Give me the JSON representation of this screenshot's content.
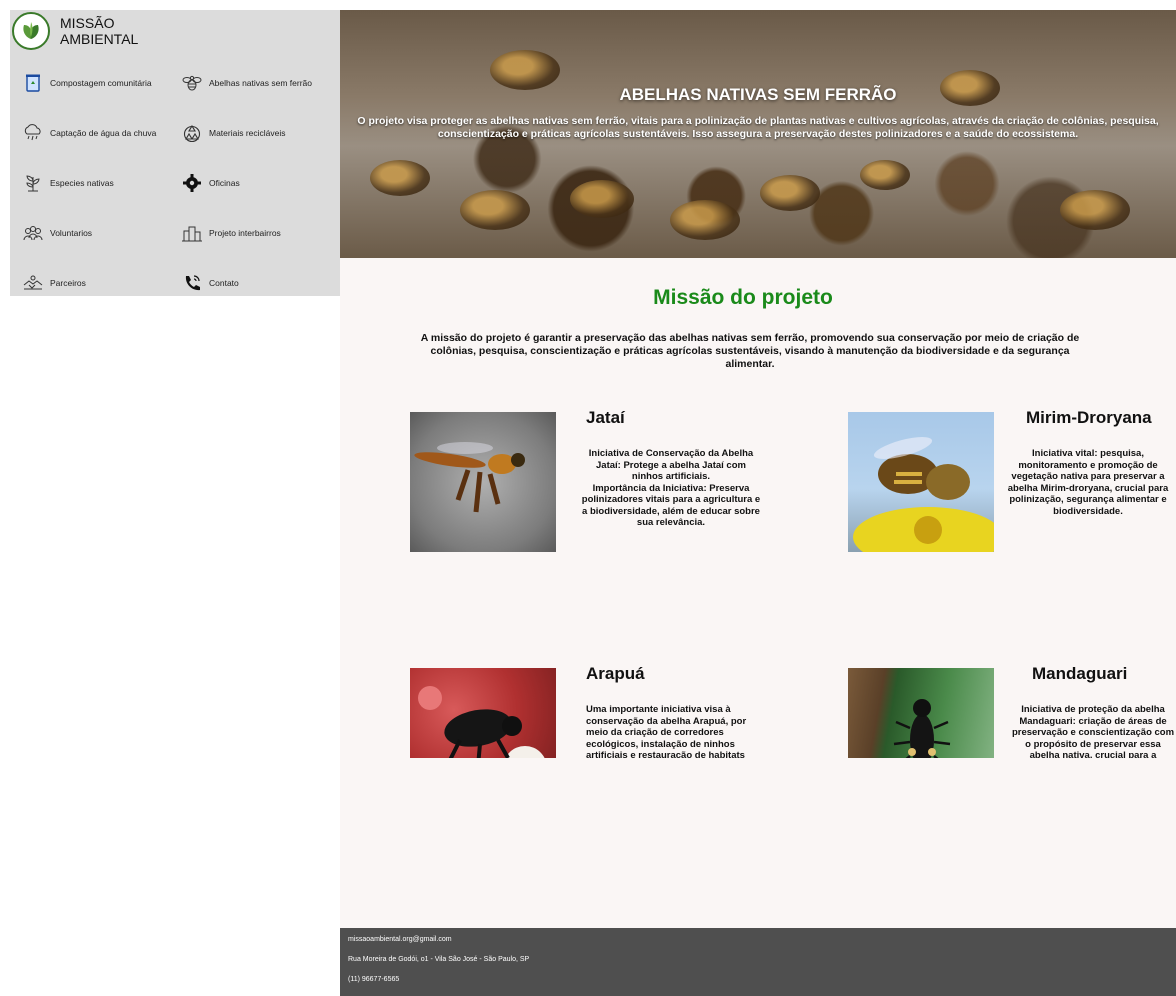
{
  "brand": {
    "line1": "MISSÃO",
    "line2": "AMBIENTAL"
  },
  "nav": [
    {
      "label": "Compostagem comunitária",
      "icon": "compost-bin-icon"
    },
    {
      "label": "Abelhas nativas sem ferrão",
      "icon": "bee-icon"
    },
    {
      "label": "Captação de água da chuva",
      "icon": "rain-cloud-icon"
    },
    {
      "label": "Materiais recicláveis",
      "icon": "recycle-icon"
    },
    {
      "label": "Especies nativas",
      "icon": "plant-icon"
    },
    {
      "label": "Oficinas",
      "icon": "gear-icon"
    },
    {
      "label": "Voluntarios",
      "icon": "people-icon"
    },
    {
      "label": "Projeto interbairros",
      "icon": "city-icon"
    },
    {
      "label": "Parceiros",
      "icon": "handshake-icon"
    },
    {
      "label": "Contato",
      "icon": "phone-icon"
    }
  ],
  "hero": {
    "title": "ABELHAS NATIVAS SEM FERRÃO",
    "text": "O projeto visa proteger as abelhas nativas sem ferrão, vitais para a polinização de plantas nativas e cultivos agrícolas, através da criação de colônias, pesquisa, conscientização e práticas agrícolas sustentáveis. Isso assegura a preservação destes polinizadores e a saúde do ecossistema."
  },
  "mission": {
    "title": "Missão do projeto",
    "text": "A missão do projeto é garantir a preservação das abelhas nativas sem ferrão, promovendo sua conservação por meio de criação de colônias, pesquisa, conscientização e práticas agrícolas sustentáveis, visando à manutenção da biodiversidade e da segurança alimentar."
  },
  "cards": [
    {
      "title": "Jataí",
      "text": "Iniciativa de Conservação da Abelha Jataí: Protege a abelha Jataí com ninhos artificiais.\nImportância da Iniciativa: Preserva polinizadores vitais para a agricultura e a biodiversidade, além de educar sobre sua relevância."
    },
    {
      "title": "Mirim-Droryana",
      "text": "Iniciativa vital: pesquisa, monitoramento e promoção de vegetação nativa para preservar a abelha Mirim-droryana, crucial para polinização, segurança alimentar e biodiversidade."
    },
    {
      "title": "Arapuá",
      "text": "Uma importante iniciativa visa à conservação da abelha Arapuá, por meio da criação de corredores ecológicos, instalação de ninhos artificiais e restauração de habitats naturais. Isso é fundamental para a preservação da espécie, essencial na polinização e na manutenção da biodiversidade."
    },
    {
      "title": "Mandaguari",
      "text": "Iniciativa de proteção da abelha Mandaguari: criação de áreas de preservação e conscientização com o propósito de preservar essa abelha nativa, crucial para a biodiversidade e práticas agrícolas sustentáveis."
    }
  ],
  "footer": {
    "email": "missaoambiental.org@gmail.com",
    "address": "Rua Moreira de Godói, o1 - Vila São José - São Paulo, SP",
    "phone": "(11) 96677-6565"
  }
}
